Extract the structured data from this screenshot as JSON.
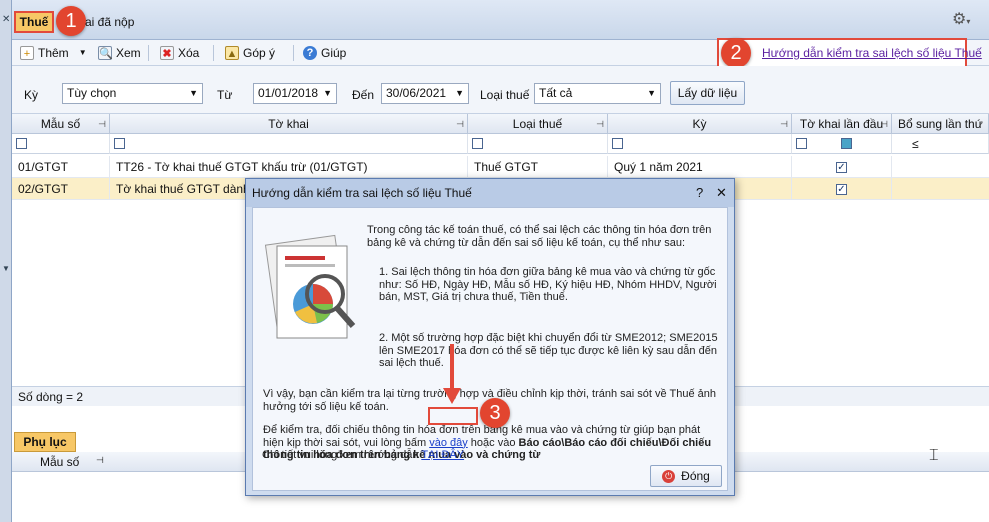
{
  "tabs": {
    "active": "Thuế",
    "other": "ai đã nộp"
  },
  "badges": {
    "b1": "1",
    "b2": "2",
    "b3": "3"
  },
  "toolbar": {
    "add": "Thêm",
    "view": "Xem",
    "delete": "Xóa",
    "feedback": "Góp ý",
    "help": "Giúp",
    "guide_link": "Hướng dẫn kiểm tra sai lệch số liệu Thuế"
  },
  "filter": {
    "period_label": "Kỳ",
    "period_value": "Tùy chọn",
    "from_label": "Từ",
    "from_value": "01/01/2018",
    "to_label": "Đến",
    "to_value": "30/06/2021",
    "tax_type_label": "Loại thuế",
    "tax_type_value": "Tất cả",
    "get_data": "Lấy dữ liệu"
  },
  "grid": {
    "headers": [
      "Mẫu số",
      "Tờ khai",
      "Loại thuế",
      "Kỳ",
      "Tờ khai lần đầu",
      "Bổ sung lần thứ"
    ],
    "filter_op": "≤",
    "rows": [
      {
        "mau_so": "01/GTGT",
        "to_khai": "TT26 - Tờ khai thuế GTGT khấu trừ (01/GTGT)",
        "loai_thue": "Thuế GTGT",
        "ky": "Quý 1 năm 2021"
      },
      {
        "mau_so": "02/GTGT",
        "to_khai": "Tờ khai thuế GTGT dành",
        "loai_thue": "",
        "ky": ""
      }
    ],
    "row_count": "Số dòng = 2"
  },
  "appendix": {
    "tab": "Phụ lục",
    "col": "Mẫu số"
  },
  "dialog": {
    "title": "Hướng dẫn kiểm tra sai lệch số liệu Thuế",
    "help_btn": "?",
    "close_x": "✕",
    "intro": "Trong công tác kế toán thuế, có thể sai lệch các thông tin hóa đơn trên bảng kê và chứng từ dẫn đến sai số liệu kế toán, cụ thể như sau:",
    "item1": "1. Sai lệch thông tin hóa đơn giữa bảng kê mua vào và chứng từ gốc như: Số HĐ, Ngày HĐ, Mẫu số HĐ, Ký hiệu HĐ, Nhóm HHDV, Người bán, MST, Giá trị chưa thuế, Tiền thuế.",
    "item2": "2. Một số trường hợp đặc biệt khi chuyển đổi từ SME2012; SME2015 lên SME2017 hóa đơn có thể sẽ tiếp tục được kê liên kỳ sau dẫn đến sai lệch thuế.",
    "conclusion": "Vì vậy, bạn cần kiểm tra lại từng trường hợp và điều chỉnh kịp thời, tránh sai sót về Thuế ảnh hưởng tới số liệu kế toán.",
    "check_pre": "Để kiểm tra, đối chiếu thông tin hóa đơn trên bảng kê mua vào và chứng từ giúp bạn phát hiện kịp thời sai sót, vui lòng bấm",
    "check_link": "vào đây",
    "check_mid": "hoặc vào",
    "check_bold": "Báo cáo\\Báo cáo đối chiếu\\Đối chiếu thông tin hóa đơn trên bảng kê mua vào và chứng từ",
    "detail_pre": "Chi tiết vui lòng xem hướng dẫn",
    "detail_link": "TẠI ĐÂY",
    "close_button": "Đóng"
  }
}
